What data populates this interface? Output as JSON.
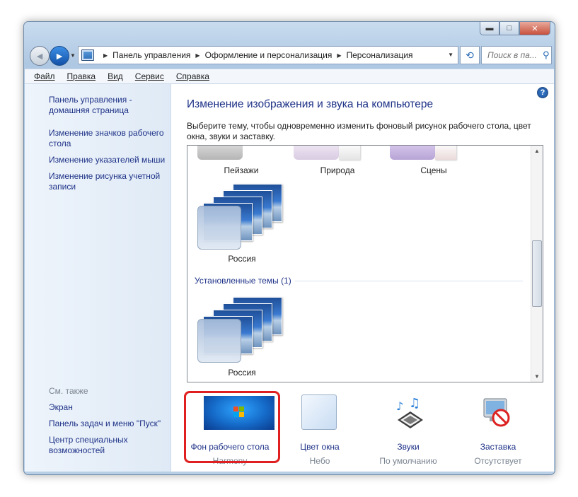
{
  "window": {
    "minimize_glyph": "▬",
    "maximize_glyph": "□",
    "close_glyph": "✕"
  },
  "nav": {
    "back_glyph": "◄",
    "forward_glyph": "►",
    "breadcrumb": [
      "Панель управления",
      "Оформление и персонализация",
      "Персонализация"
    ],
    "search_placeholder": "Поиск в па..."
  },
  "menu": [
    "Файл",
    "Правка",
    "Вид",
    "Сервис",
    "Справка"
  ],
  "sidebar": {
    "links": [
      "Панель управления - домашняя страница",
      "Изменение значков рабочего стола",
      "Изменение указателей мыши",
      "Изменение рисунка учетной записи"
    ],
    "see_also_caption": "См. также",
    "see_also": [
      "Экран",
      "Панель задач и меню \"Пуск\"",
      "Центр специальных возможностей"
    ]
  },
  "main": {
    "help_glyph": "?",
    "title": "Изменение изображения и звука на компьютере",
    "description": "Выберите тему, чтобы одновременно изменить фоновый рисунок рабочего стола, цвет окна, звуки и заставку.",
    "themes_partial": [
      "Пейзажи",
      "Природа",
      "Сцены"
    ],
    "theme_russia_1": "Россия",
    "installed_header": "Установленные темы (1)",
    "theme_russia_2": "Россия"
  },
  "bottom": {
    "wallpaper": {
      "label": "Фон рабочего стола",
      "value": "Harmony"
    },
    "color": {
      "label": "Цвет окна",
      "value": "Небо"
    },
    "sounds": {
      "label": "Звуки",
      "value": "По умолчанию"
    },
    "saver": {
      "label": "Заставка",
      "value": "Отсутствует"
    }
  },
  "colors": {
    "link": "#1e3287",
    "highlight_box": "#e02020",
    "accent_blue": "#2b6cb6"
  }
}
